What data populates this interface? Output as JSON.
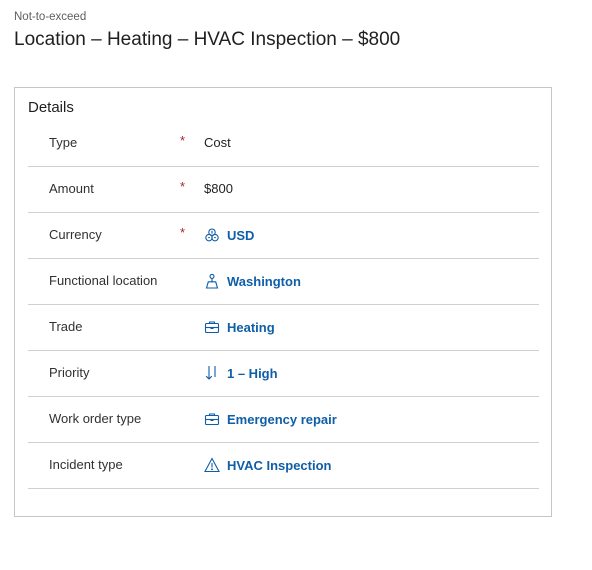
{
  "header": {
    "subtitle": "Not-to-exceed",
    "title": "Location – Heating – HVAC Inspection – $800"
  },
  "details": {
    "title": "Details",
    "required_marker": "*",
    "rows": [
      {
        "label": "Type",
        "required": true,
        "value": "Cost",
        "link": false,
        "icon": null
      },
      {
        "label": "Amount",
        "required": true,
        "value": "$800",
        "link": false,
        "icon": null
      },
      {
        "label": "Currency",
        "required": true,
        "value": "USD",
        "link": true,
        "icon": "currency-icon"
      },
      {
        "label": "Functional location",
        "required": false,
        "value": "Washington",
        "link": true,
        "icon": "location-icon"
      },
      {
        "label": "Trade",
        "required": false,
        "value": "Heating",
        "link": true,
        "icon": "briefcase-icon"
      },
      {
        "label": "Priority",
        "required": false,
        "value": "1 – High",
        "link": true,
        "icon": "priority-arrows-icon"
      },
      {
        "label": "Work order type",
        "required": false,
        "value": "Emergency repair",
        "link": true,
        "icon": "briefcase-icon"
      },
      {
        "label": "Incident type",
        "required": false,
        "value": "HVAC Inspection",
        "link": true,
        "icon": "warning-icon"
      }
    ]
  },
  "colors": {
    "link": "#0f5ea8",
    "required": "#a4262c",
    "border": "#c8c6c4"
  }
}
